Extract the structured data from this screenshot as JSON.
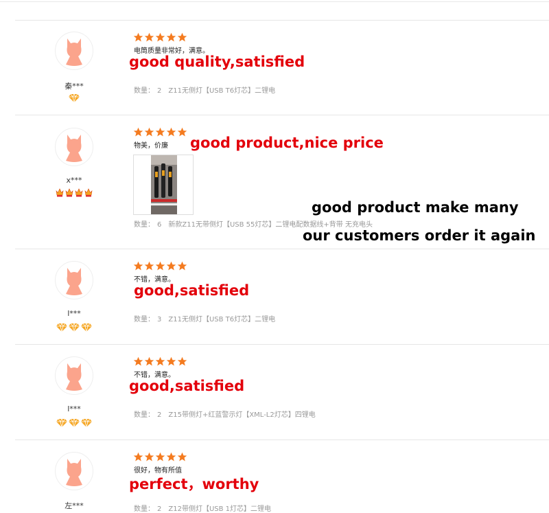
{
  "colors": {
    "accent_red": "#e3000b",
    "star_orange": "#f47b20",
    "avatar_salmon": "#fba48c"
  },
  "reviews": [
    {
      "username": "秦***",
      "rating": 5,
      "badge": "diamond-1",
      "comment": "电筒质量非常好，满意。",
      "translation": "good quality,satisfied",
      "quantity_label": "数量：",
      "quantity": "2",
      "variant": "Z11无侧灯【USB T6灯芯】二锂电"
    },
    {
      "username": "x***",
      "rating": 5,
      "badge": "crown-4",
      "comment": "物美，价廉",
      "translation": "good product,nice price",
      "quantity_label": "数量：",
      "quantity": "6",
      "variant": "新款Z11无带侧灯【USB 55灯芯】二锂电配数据线+背带 无充电头"
    },
    {
      "username": "l***",
      "rating": 5,
      "badge": "diamond-3",
      "comment": "不错，满意。",
      "translation": "good,satisfied",
      "quantity_label": "数量：",
      "quantity": "3",
      "variant": "Z11无侧灯【USB T6灯芯】二锂电"
    },
    {
      "username": "l***",
      "rating": 5,
      "badge": "diamond-3",
      "comment": "不错，满意。",
      "translation": "good,satisfied",
      "quantity_label": "数量：",
      "quantity": "2",
      "variant": "Z15带侧灯+红蓝警示灯【XML-L2灯芯】四锂电"
    },
    {
      "username": "左***",
      "rating": 5,
      "badge": "",
      "comment": "很好，物有所值",
      "translation": "perfect，worthy",
      "quantity_label": "数量：",
      "quantity": "2",
      "variant": "Z12带侧灯【USB 1灯芯】二锂电"
    }
  ],
  "callout": {
    "line1": "good product make many",
    "line2": "our customers order it again"
  }
}
